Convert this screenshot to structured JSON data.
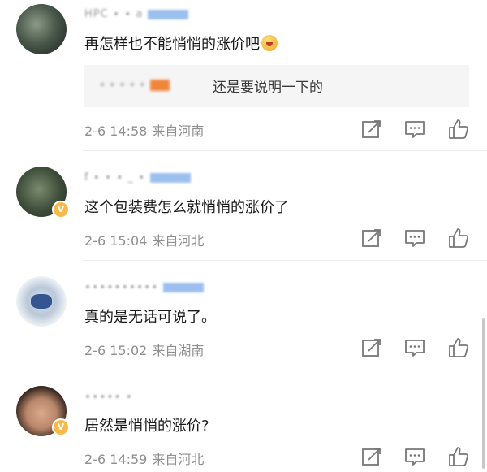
{
  "comments": [
    {
      "name": "HPC ∙ ∙ a",
      "text": "再怎样也不能悄悄的涨价吧",
      "has_emoji": true,
      "reply": {
        "name": "∙ ∙ ∙ ∙ ∙",
        "text": "还是要说明一下的"
      },
      "date": "2-6 14:58",
      "location": "来自河南"
    },
    {
      "name": "f ∙ ∙ ∙ _ ∙",
      "text": "这个包装费怎么就悄悄的涨价了",
      "date": "2-6 15:04",
      "location": "来自河北"
    },
    {
      "name": "∙∙∙∙∙∙∙∙∙∙",
      "text": "真的是无话可说了。",
      "date": "2-6 15:02",
      "location": "来自湖南"
    },
    {
      "name": "∙∙∙∙∙ ∙",
      "text": "居然是悄悄的涨价?",
      "date": "2-6 14:59",
      "location": "来自河北"
    }
  ],
  "icons": {
    "share": "share-icon",
    "comment": "comment-icon",
    "like": "thumbs-up-icon"
  },
  "colors": {
    "meta": "#8f8f8f",
    "tag_blue": "#9cc0ee",
    "reply_bg": "#f5f5f5",
    "badge": "#f6b94b"
  }
}
